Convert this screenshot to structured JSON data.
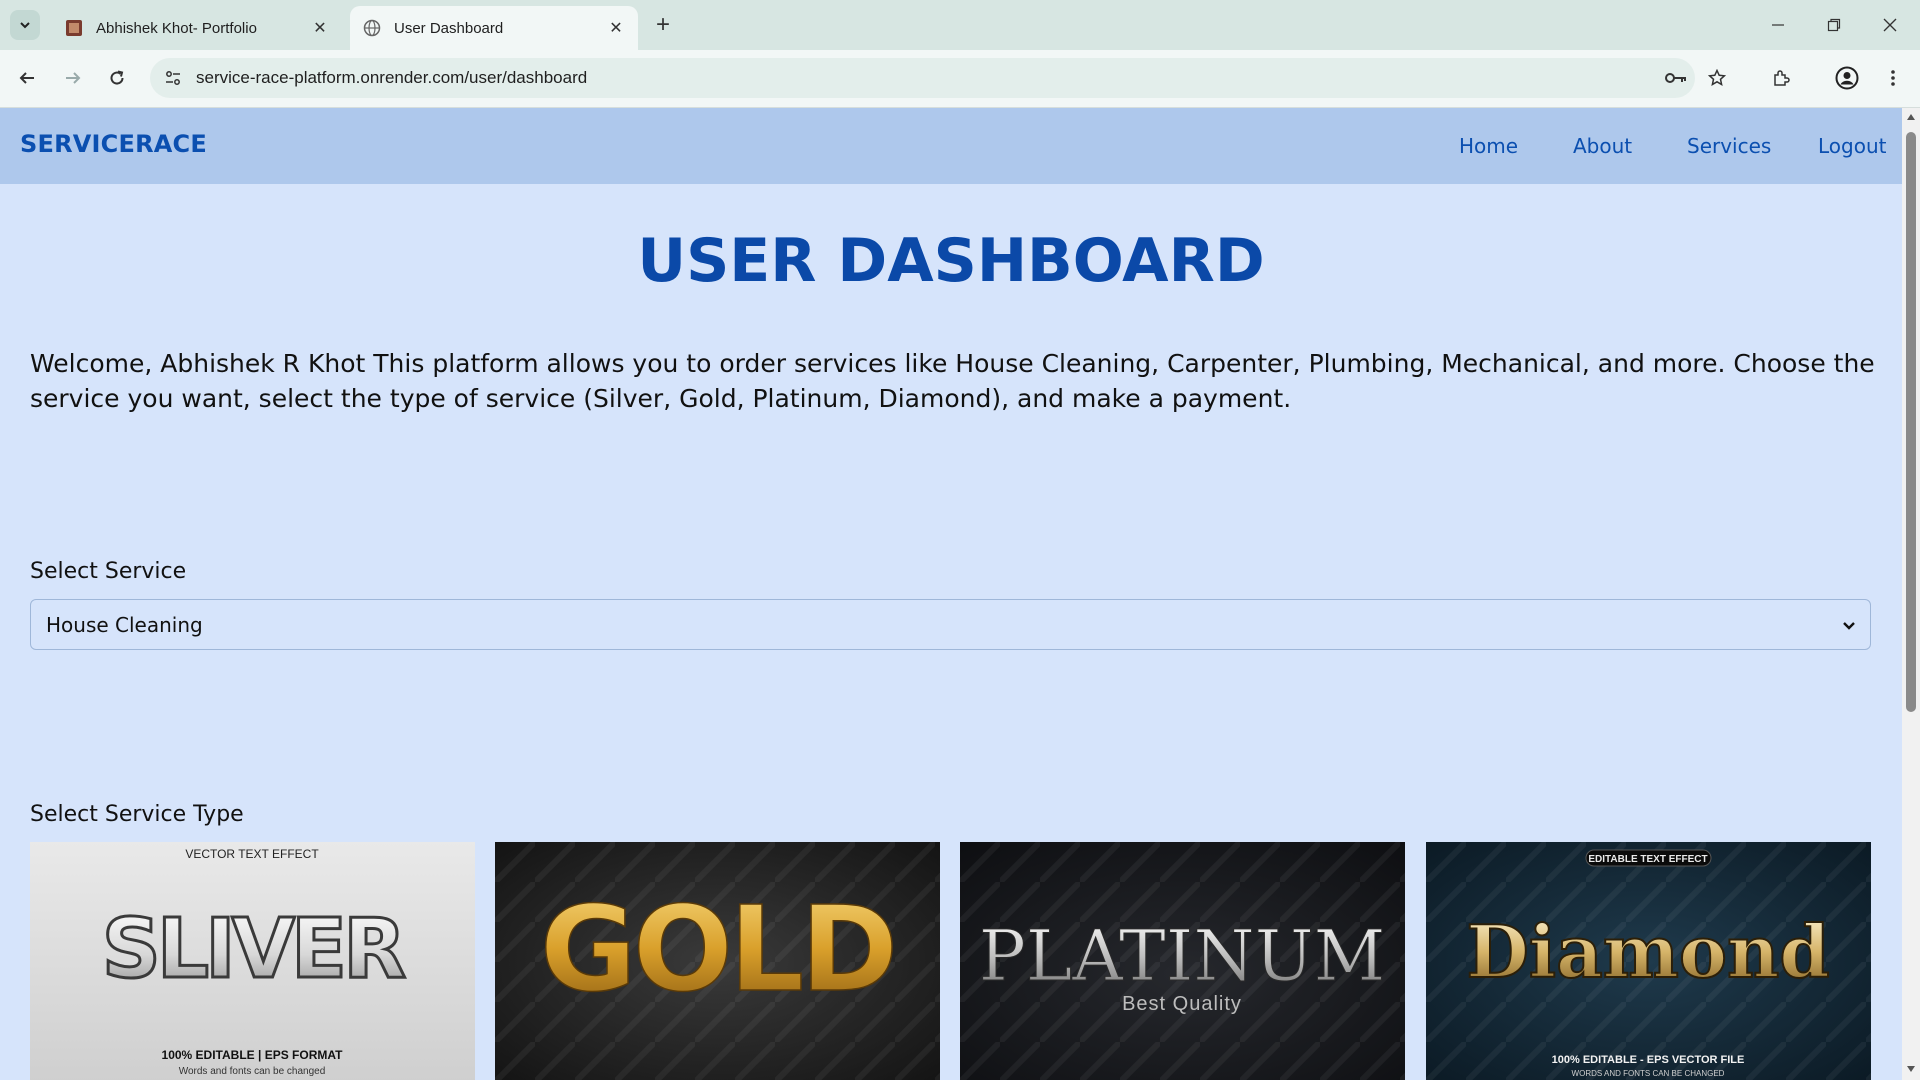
{
  "browser": {
    "tabs": [
      {
        "title": "Abhishek Khot- Portfolio",
        "active": false
      },
      {
        "title": "User Dashboard",
        "active": true
      }
    ],
    "url": "service-race-platform.onrender.com/user/dashboard"
  },
  "navbar": {
    "brand": "SERVICERACE",
    "links": [
      "Home",
      "About",
      "Services",
      "Logout"
    ]
  },
  "main": {
    "heading": "USER DASHBOARD",
    "welcome": "Welcome, Abhishek R Khot This platform allows you to order services like House Cleaning, Carpenter, Plumbing, Mechanical, and more. Choose the service you want, select the type of service (Silver, Gold, Platinum, Diamond), and make a payment.",
    "select_service_label": "Select Service",
    "select_service_value": "House Cleaning",
    "select_type_label": "Select Service Type",
    "service_types": [
      {
        "art_text": "SLIVER",
        "top_caption": "VECTOR TEXT EFFECT",
        "bottom_caption": "100% EDITABLE | EPS FORMAT",
        "bottom_sub": "Words and fonts can be changed"
      },
      {
        "art_text": "GOLD"
      },
      {
        "art_text": "PLATINUM",
        "sub": "Best Quality"
      },
      {
        "art_text": "Diamond",
        "top_caption": "EDITABLE TEXT EFFECT",
        "bottom_caption": "100% EDITABLE - EPS VECTOR FILE",
        "bottom_sub": "WORDS AND FONTS CAN BE CHANGED"
      }
    ]
  },
  "colors": {
    "navbar_bg": "#aec8ec",
    "page_bg": "#d6e4fb",
    "brand": "#0b4fb0"
  }
}
